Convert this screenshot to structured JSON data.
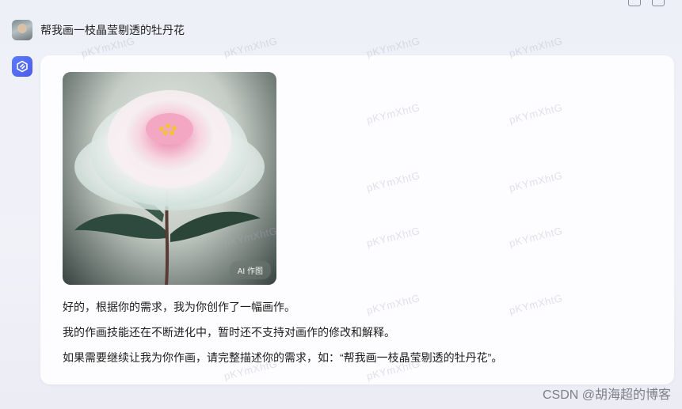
{
  "user_message": "帮我画一枝晶莹剔透的牡丹花",
  "image": {
    "badge": "AI 作图"
  },
  "reply": {
    "line1": "好的，根据你的需求，我为你创作了一幅画作。",
    "line2": "我的作画技能还在不断进化中，暂时还不支持对画作的修改和解释。",
    "line3": "如果需要继续让我为你作画，请完整描述你的需求，如：“帮我画一枝晶莹剔透的牡丹花”。"
  },
  "watermark_text": "pKYmXhtG",
  "footer_watermark": "CSDN @胡海超的博客",
  "colors": {
    "accent": "#5a7bff",
    "card_bg": "#fdfdff",
    "page_bg": "#eef0f8"
  },
  "icons": [
    "user-avatar",
    "bot-logo-icon",
    "copy-icon",
    "share-icon"
  ]
}
